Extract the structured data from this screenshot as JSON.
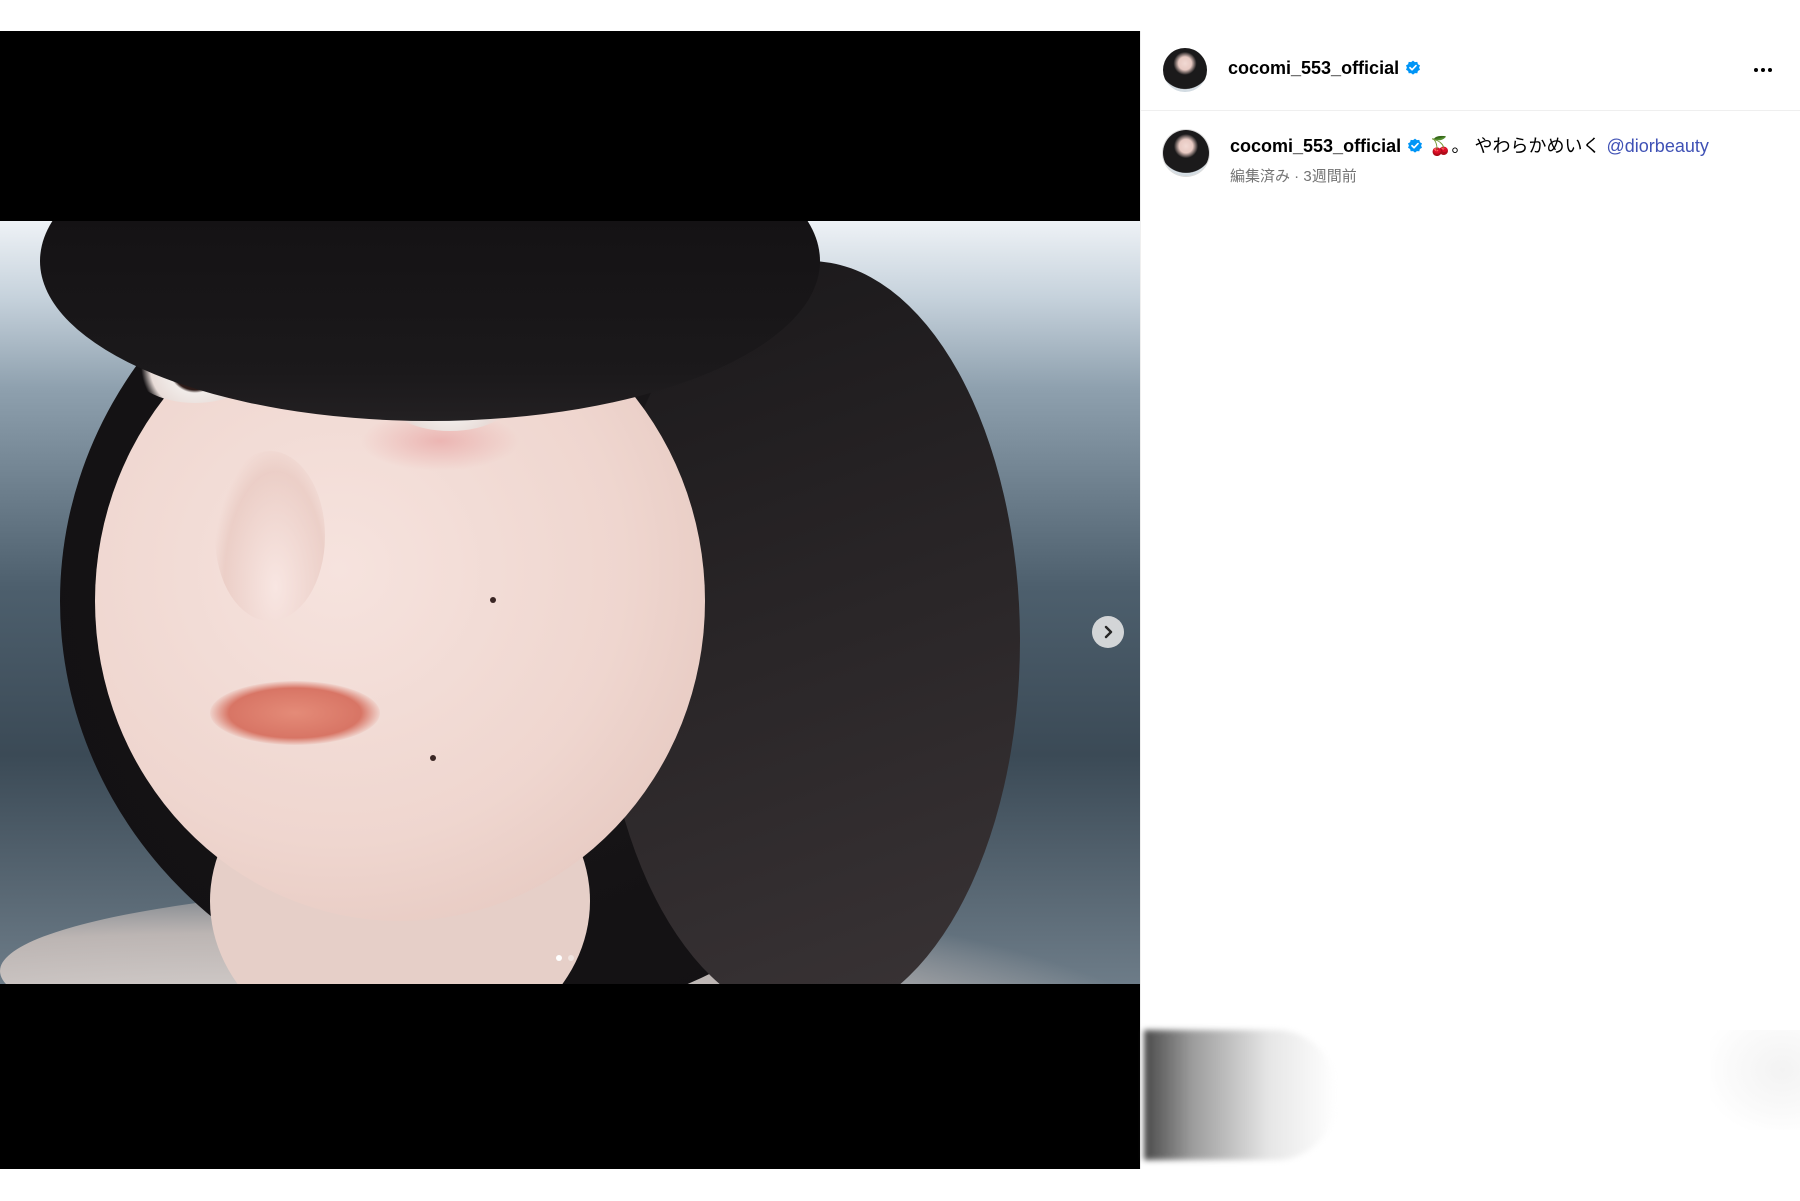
{
  "post": {
    "username": "cocomi_553_official",
    "verified": true,
    "caption_text": "🍒。 やわらかめいく",
    "mention": "@diorbeauty",
    "edited": "編集済み",
    "time_ago": "3週間前",
    "meta_separator": " · "
  },
  "carousel": {
    "slide_count": 2,
    "active_slide": 1
  },
  "icons": {
    "verified": "verified-badge-icon",
    "more": "more-options-icon",
    "next": "chevron-right-icon"
  },
  "colors": {
    "mention": "#3f51b5",
    "verified_badge": "#0095f6",
    "meta_text": "#737373"
  }
}
